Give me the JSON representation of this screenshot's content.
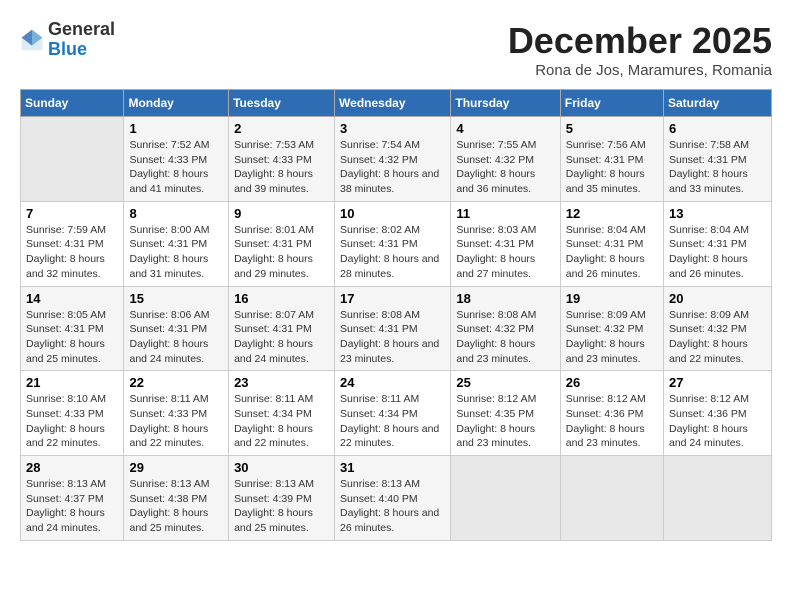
{
  "logo": {
    "general": "General",
    "blue": "Blue"
  },
  "title": "December 2025",
  "subtitle": "Rona de Jos, Maramures, Romania",
  "days_of_week": [
    "Sunday",
    "Monday",
    "Tuesday",
    "Wednesday",
    "Thursday",
    "Friday",
    "Saturday"
  ],
  "weeks": [
    [
      {
        "day": "",
        "sunrise": "",
        "sunset": "",
        "daylight": "",
        "empty": true
      },
      {
        "day": "1",
        "sunrise": "Sunrise: 7:52 AM",
        "sunset": "Sunset: 4:33 PM",
        "daylight": "Daylight: 8 hours and 41 minutes."
      },
      {
        "day": "2",
        "sunrise": "Sunrise: 7:53 AM",
        "sunset": "Sunset: 4:33 PM",
        "daylight": "Daylight: 8 hours and 39 minutes."
      },
      {
        "day": "3",
        "sunrise": "Sunrise: 7:54 AM",
        "sunset": "Sunset: 4:32 PM",
        "daylight": "Daylight: 8 hours and 38 minutes."
      },
      {
        "day": "4",
        "sunrise": "Sunrise: 7:55 AM",
        "sunset": "Sunset: 4:32 PM",
        "daylight": "Daylight: 8 hours and 36 minutes."
      },
      {
        "day": "5",
        "sunrise": "Sunrise: 7:56 AM",
        "sunset": "Sunset: 4:31 PM",
        "daylight": "Daylight: 8 hours and 35 minutes."
      },
      {
        "day": "6",
        "sunrise": "Sunrise: 7:58 AM",
        "sunset": "Sunset: 4:31 PM",
        "daylight": "Daylight: 8 hours and 33 minutes."
      }
    ],
    [
      {
        "day": "7",
        "sunrise": "Sunrise: 7:59 AM",
        "sunset": "Sunset: 4:31 PM",
        "daylight": "Daylight: 8 hours and 32 minutes."
      },
      {
        "day": "8",
        "sunrise": "Sunrise: 8:00 AM",
        "sunset": "Sunset: 4:31 PM",
        "daylight": "Daylight: 8 hours and 31 minutes."
      },
      {
        "day": "9",
        "sunrise": "Sunrise: 8:01 AM",
        "sunset": "Sunset: 4:31 PM",
        "daylight": "Daylight: 8 hours and 29 minutes."
      },
      {
        "day": "10",
        "sunrise": "Sunrise: 8:02 AM",
        "sunset": "Sunset: 4:31 PM",
        "daylight": "Daylight: 8 hours and 28 minutes."
      },
      {
        "day": "11",
        "sunrise": "Sunrise: 8:03 AM",
        "sunset": "Sunset: 4:31 PM",
        "daylight": "Daylight: 8 hours and 27 minutes."
      },
      {
        "day": "12",
        "sunrise": "Sunrise: 8:04 AM",
        "sunset": "Sunset: 4:31 PM",
        "daylight": "Daylight: 8 hours and 26 minutes."
      },
      {
        "day": "13",
        "sunrise": "Sunrise: 8:04 AM",
        "sunset": "Sunset: 4:31 PM",
        "daylight": "Daylight: 8 hours and 26 minutes."
      }
    ],
    [
      {
        "day": "14",
        "sunrise": "Sunrise: 8:05 AM",
        "sunset": "Sunset: 4:31 PM",
        "daylight": "Daylight: 8 hours and 25 minutes."
      },
      {
        "day": "15",
        "sunrise": "Sunrise: 8:06 AM",
        "sunset": "Sunset: 4:31 PM",
        "daylight": "Daylight: 8 hours and 24 minutes."
      },
      {
        "day": "16",
        "sunrise": "Sunrise: 8:07 AM",
        "sunset": "Sunset: 4:31 PM",
        "daylight": "Daylight: 8 hours and 24 minutes."
      },
      {
        "day": "17",
        "sunrise": "Sunrise: 8:08 AM",
        "sunset": "Sunset: 4:31 PM",
        "daylight": "Daylight: 8 hours and 23 minutes."
      },
      {
        "day": "18",
        "sunrise": "Sunrise: 8:08 AM",
        "sunset": "Sunset: 4:32 PM",
        "daylight": "Daylight: 8 hours and 23 minutes."
      },
      {
        "day": "19",
        "sunrise": "Sunrise: 8:09 AM",
        "sunset": "Sunset: 4:32 PM",
        "daylight": "Daylight: 8 hours and 23 minutes."
      },
      {
        "day": "20",
        "sunrise": "Sunrise: 8:09 AM",
        "sunset": "Sunset: 4:32 PM",
        "daylight": "Daylight: 8 hours and 22 minutes."
      }
    ],
    [
      {
        "day": "21",
        "sunrise": "Sunrise: 8:10 AM",
        "sunset": "Sunset: 4:33 PM",
        "daylight": "Daylight: 8 hours and 22 minutes."
      },
      {
        "day": "22",
        "sunrise": "Sunrise: 8:11 AM",
        "sunset": "Sunset: 4:33 PM",
        "daylight": "Daylight: 8 hours and 22 minutes."
      },
      {
        "day": "23",
        "sunrise": "Sunrise: 8:11 AM",
        "sunset": "Sunset: 4:34 PM",
        "daylight": "Daylight: 8 hours and 22 minutes."
      },
      {
        "day": "24",
        "sunrise": "Sunrise: 8:11 AM",
        "sunset": "Sunset: 4:34 PM",
        "daylight": "Daylight: 8 hours and 22 minutes."
      },
      {
        "day": "25",
        "sunrise": "Sunrise: 8:12 AM",
        "sunset": "Sunset: 4:35 PM",
        "daylight": "Daylight: 8 hours and 23 minutes."
      },
      {
        "day": "26",
        "sunrise": "Sunrise: 8:12 AM",
        "sunset": "Sunset: 4:36 PM",
        "daylight": "Daylight: 8 hours and 23 minutes."
      },
      {
        "day": "27",
        "sunrise": "Sunrise: 8:12 AM",
        "sunset": "Sunset: 4:36 PM",
        "daylight": "Daylight: 8 hours and 24 minutes."
      }
    ],
    [
      {
        "day": "28",
        "sunrise": "Sunrise: 8:13 AM",
        "sunset": "Sunset: 4:37 PM",
        "daylight": "Daylight: 8 hours and 24 minutes."
      },
      {
        "day": "29",
        "sunrise": "Sunrise: 8:13 AM",
        "sunset": "Sunset: 4:38 PM",
        "daylight": "Daylight: 8 hours and 25 minutes."
      },
      {
        "day": "30",
        "sunrise": "Sunrise: 8:13 AM",
        "sunset": "Sunset: 4:39 PM",
        "daylight": "Daylight: 8 hours and 25 minutes."
      },
      {
        "day": "31",
        "sunrise": "Sunrise: 8:13 AM",
        "sunset": "Sunset: 4:40 PM",
        "daylight": "Daylight: 8 hours and 26 minutes."
      },
      {
        "day": "",
        "sunrise": "",
        "sunset": "",
        "daylight": "",
        "empty": true
      },
      {
        "day": "",
        "sunrise": "",
        "sunset": "",
        "daylight": "",
        "empty": true
      },
      {
        "day": "",
        "sunrise": "",
        "sunset": "",
        "daylight": "",
        "empty": true
      }
    ]
  ]
}
